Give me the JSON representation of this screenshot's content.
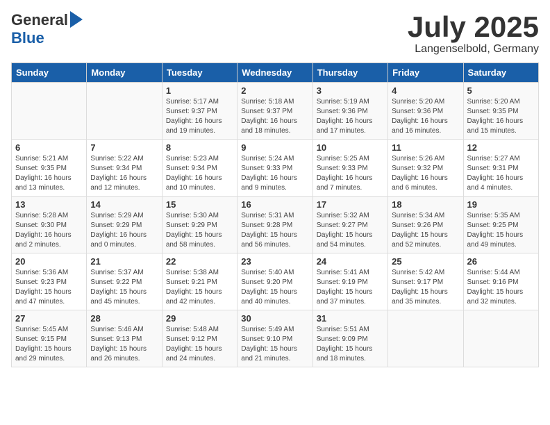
{
  "header": {
    "logo_general": "General",
    "logo_blue": "Blue",
    "month_title": "July 2025",
    "location": "Langenselbold, Germany"
  },
  "weekdays": [
    "Sunday",
    "Monday",
    "Tuesday",
    "Wednesday",
    "Thursday",
    "Friday",
    "Saturday"
  ],
  "weeks": [
    [
      {
        "day": "",
        "content": ""
      },
      {
        "day": "",
        "content": ""
      },
      {
        "day": "1",
        "content": "Sunrise: 5:17 AM\nSunset: 9:37 PM\nDaylight: 16 hours and 19 minutes."
      },
      {
        "day": "2",
        "content": "Sunrise: 5:18 AM\nSunset: 9:37 PM\nDaylight: 16 hours and 18 minutes."
      },
      {
        "day": "3",
        "content": "Sunrise: 5:19 AM\nSunset: 9:36 PM\nDaylight: 16 hours and 17 minutes."
      },
      {
        "day": "4",
        "content": "Sunrise: 5:20 AM\nSunset: 9:36 PM\nDaylight: 16 hours and 16 minutes."
      },
      {
        "day": "5",
        "content": "Sunrise: 5:20 AM\nSunset: 9:35 PM\nDaylight: 16 hours and 15 minutes."
      }
    ],
    [
      {
        "day": "6",
        "content": "Sunrise: 5:21 AM\nSunset: 9:35 PM\nDaylight: 16 hours and 13 minutes."
      },
      {
        "day": "7",
        "content": "Sunrise: 5:22 AM\nSunset: 9:34 PM\nDaylight: 16 hours and 12 minutes."
      },
      {
        "day": "8",
        "content": "Sunrise: 5:23 AM\nSunset: 9:34 PM\nDaylight: 16 hours and 10 minutes."
      },
      {
        "day": "9",
        "content": "Sunrise: 5:24 AM\nSunset: 9:33 PM\nDaylight: 16 hours and 9 minutes."
      },
      {
        "day": "10",
        "content": "Sunrise: 5:25 AM\nSunset: 9:33 PM\nDaylight: 16 hours and 7 minutes."
      },
      {
        "day": "11",
        "content": "Sunrise: 5:26 AM\nSunset: 9:32 PM\nDaylight: 16 hours and 6 minutes."
      },
      {
        "day": "12",
        "content": "Sunrise: 5:27 AM\nSunset: 9:31 PM\nDaylight: 16 hours and 4 minutes."
      }
    ],
    [
      {
        "day": "13",
        "content": "Sunrise: 5:28 AM\nSunset: 9:30 PM\nDaylight: 16 hours and 2 minutes."
      },
      {
        "day": "14",
        "content": "Sunrise: 5:29 AM\nSunset: 9:29 PM\nDaylight: 16 hours and 0 minutes."
      },
      {
        "day": "15",
        "content": "Sunrise: 5:30 AM\nSunset: 9:29 PM\nDaylight: 15 hours and 58 minutes."
      },
      {
        "day": "16",
        "content": "Sunrise: 5:31 AM\nSunset: 9:28 PM\nDaylight: 15 hours and 56 minutes."
      },
      {
        "day": "17",
        "content": "Sunrise: 5:32 AM\nSunset: 9:27 PM\nDaylight: 15 hours and 54 minutes."
      },
      {
        "day": "18",
        "content": "Sunrise: 5:34 AM\nSunset: 9:26 PM\nDaylight: 15 hours and 52 minutes."
      },
      {
        "day": "19",
        "content": "Sunrise: 5:35 AM\nSunset: 9:25 PM\nDaylight: 15 hours and 49 minutes."
      }
    ],
    [
      {
        "day": "20",
        "content": "Sunrise: 5:36 AM\nSunset: 9:23 PM\nDaylight: 15 hours and 47 minutes."
      },
      {
        "day": "21",
        "content": "Sunrise: 5:37 AM\nSunset: 9:22 PM\nDaylight: 15 hours and 45 minutes."
      },
      {
        "day": "22",
        "content": "Sunrise: 5:38 AM\nSunset: 9:21 PM\nDaylight: 15 hours and 42 minutes."
      },
      {
        "day": "23",
        "content": "Sunrise: 5:40 AM\nSunset: 9:20 PM\nDaylight: 15 hours and 40 minutes."
      },
      {
        "day": "24",
        "content": "Sunrise: 5:41 AM\nSunset: 9:19 PM\nDaylight: 15 hours and 37 minutes."
      },
      {
        "day": "25",
        "content": "Sunrise: 5:42 AM\nSunset: 9:17 PM\nDaylight: 15 hours and 35 minutes."
      },
      {
        "day": "26",
        "content": "Sunrise: 5:44 AM\nSunset: 9:16 PM\nDaylight: 15 hours and 32 minutes."
      }
    ],
    [
      {
        "day": "27",
        "content": "Sunrise: 5:45 AM\nSunset: 9:15 PM\nDaylight: 15 hours and 29 minutes."
      },
      {
        "day": "28",
        "content": "Sunrise: 5:46 AM\nSunset: 9:13 PM\nDaylight: 15 hours and 26 minutes."
      },
      {
        "day": "29",
        "content": "Sunrise: 5:48 AM\nSunset: 9:12 PM\nDaylight: 15 hours and 24 minutes."
      },
      {
        "day": "30",
        "content": "Sunrise: 5:49 AM\nSunset: 9:10 PM\nDaylight: 15 hours and 21 minutes."
      },
      {
        "day": "31",
        "content": "Sunrise: 5:51 AM\nSunset: 9:09 PM\nDaylight: 15 hours and 18 minutes."
      },
      {
        "day": "",
        "content": ""
      },
      {
        "day": "",
        "content": ""
      }
    ]
  ]
}
